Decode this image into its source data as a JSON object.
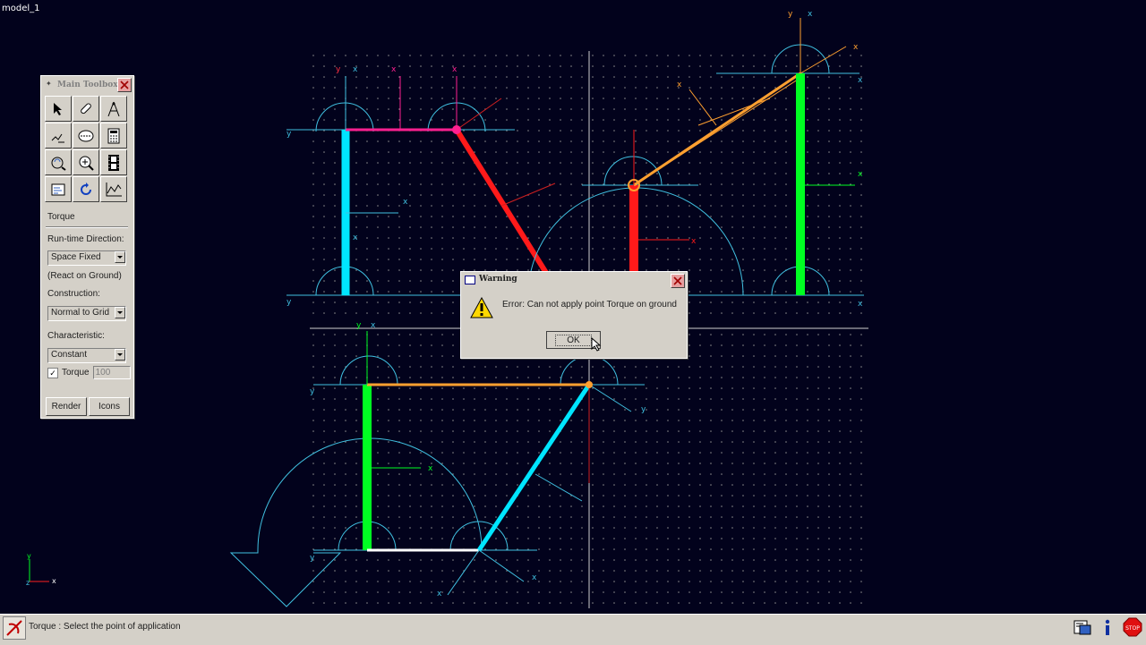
{
  "window": {
    "title": "model_1"
  },
  "viewport": {
    "axis_triad": {
      "x": "x",
      "y": "y",
      "z": "z"
    }
  },
  "toolbox": {
    "title": "Main Toolbox",
    "tools": [
      {
        "name": "select-arrow-icon"
      },
      {
        "name": "link-tool-icon"
      },
      {
        "name": "joint-compass-icon"
      },
      {
        "name": "spring-tool-icon"
      },
      {
        "name": "motor-tool-icon"
      },
      {
        "name": "calculator-icon"
      },
      {
        "name": "rotate-view-icon"
      },
      {
        "name": "zoom-view-icon"
      },
      {
        "name": "film-strip-icon"
      },
      {
        "name": "properties-icon"
      },
      {
        "name": "undo-rotate-icon"
      },
      {
        "name": "graph-icon"
      }
    ],
    "section_title": "Torque",
    "runtime_direction_label": "Run-time Direction:",
    "runtime_direction_value": "Space Fixed",
    "react_note": "(React on Ground)",
    "construction_label": "Construction:",
    "construction_value": "Normal to Grid",
    "characteristic_label": "Characteristic:",
    "characteristic_value": "Constant",
    "torque_checked": true,
    "torque_label": "Torque",
    "torque_value": "100",
    "render_label": "Render",
    "icons_label": "Icons"
  },
  "dialog": {
    "title": "Warning",
    "message": "Error: Can not apply point Torque on ground",
    "ok_label": "OK"
  },
  "statusbar": {
    "text": "Torque : Select the point of application",
    "icons": [
      "tool-settings-icon",
      "info-icon",
      "stop-icon"
    ]
  },
  "colors": {
    "background": "#02021c",
    "cyan_link": "#00e5ff",
    "green_link": "#00ff22",
    "red_link": "#ff1a1a",
    "orange_link": "#ffa030",
    "magenta_link": "#ff2090",
    "grid_dots": "#9a9a9a"
  }
}
